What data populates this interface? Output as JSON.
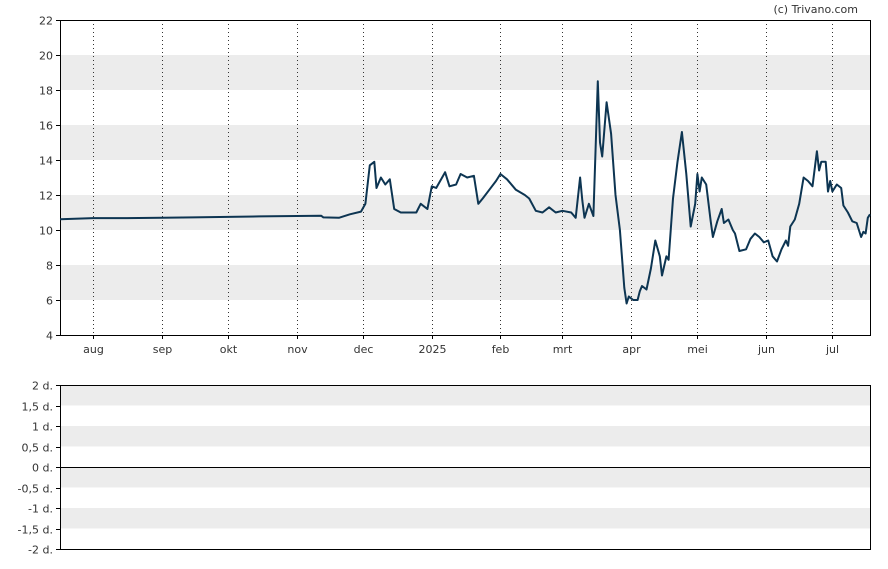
{
  "watermark": "(c) Trivano.com",
  "colors": {
    "line": "#0d3552",
    "band": "#ececec",
    "grid": "#333333",
    "axis": "#000000",
    "text": "#333333"
  },
  "chart_data": [
    {
      "type": "line",
      "title": "",
      "ylim": [
        4,
        22
      ],
      "y_ticks": [
        "4",
        "6",
        "8",
        "10",
        "12",
        "14",
        "16",
        "18",
        "20",
        "22"
      ],
      "x_tick_labels": [
        "aug",
        "sep",
        "okt",
        "nov",
        "dec",
        "2025",
        "feb",
        "mrt",
        "apr",
        "mei",
        "jun",
        "jul"
      ],
      "x_tick_dates": [
        "2024-08-01",
        "2024-09-01",
        "2024-10-01",
        "2024-11-01",
        "2024-12-01",
        "2025-01-01",
        "2025-02-01",
        "2025-03-01",
        "2025-04-01",
        "2025-05-01",
        "2025-06-01",
        "2025-07-01"
      ],
      "x_range": [
        "2024-07-17",
        "2025-07-18"
      ],
      "grid": "vertical dotted at month starts, alternating horizontal bands",
      "series": [
        {
          "points": [
            [
              "2024-07-17",
              10.62
            ],
            [
              "2024-08-01",
              10.68
            ],
            [
              "2024-08-15",
              10.68
            ],
            [
              "2024-09-01",
              10.7
            ],
            [
              "2024-09-15",
              10.72
            ],
            [
              "2024-10-01",
              10.75
            ],
            [
              "2024-10-15",
              10.78
            ],
            [
              "2024-11-01",
              10.8
            ],
            [
              "2024-11-12",
              10.82
            ],
            [
              "2024-11-13",
              10.72
            ],
            [
              "2024-11-20",
              10.7
            ],
            [
              "2024-11-25",
              10.9
            ],
            [
              "2024-11-30",
              11.05
            ],
            [
              "2024-12-02",
              11.5
            ],
            [
              "2024-12-04",
              13.7
            ],
            [
              "2024-12-06",
              13.9
            ],
            [
              "2024-12-07",
              12.4
            ],
            [
              "2024-12-09",
              13.0
            ],
            [
              "2024-12-11",
              12.6
            ],
            [
              "2024-12-13",
              12.9
            ],
            [
              "2024-12-15",
              11.2
            ],
            [
              "2024-12-18",
              11.0
            ],
            [
              "2024-12-25",
              11.0
            ],
            [
              "2024-12-27",
              11.5
            ],
            [
              "2024-12-30",
              11.2
            ],
            [
              "2025-01-01",
              12.5
            ],
            [
              "2025-01-03",
              12.4
            ],
            [
              "2025-01-07",
              13.3
            ],
            [
              "2025-01-09",
              12.5
            ],
            [
              "2025-01-12",
              12.6
            ],
            [
              "2025-01-14",
              13.2
            ],
            [
              "2025-01-17",
              13.0
            ],
            [
              "2025-01-20",
              13.1
            ],
            [
              "2025-01-22",
              11.5
            ],
            [
              "2025-01-24",
              11.8
            ],
            [
              "2025-01-27",
              12.3
            ],
            [
              "2025-01-30",
              12.8
            ],
            [
              "2025-02-01",
              13.2
            ],
            [
              "2025-02-04",
              12.9
            ],
            [
              "2025-02-08",
              12.3
            ],
            [
              "2025-02-12",
              12.0
            ],
            [
              "2025-02-14",
              11.8
            ],
            [
              "2025-02-17",
              11.1
            ],
            [
              "2025-02-20",
              11.0
            ],
            [
              "2025-02-23",
              11.3
            ],
            [
              "2025-02-26",
              11.0
            ],
            [
              "2025-03-01",
              11.1
            ],
            [
              "2025-03-05",
              11.0
            ],
            [
              "2025-03-07",
              10.7
            ],
            [
              "2025-03-09",
              13.0
            ],
            [
              "2025-03-10",
              11.7
            ],
            [
              "2025-03-11",
              10.7
            ],
            [
              "2025-03-13",
              11.5
            ],
            [
              "2025-03-15",
              10.8
            ],
            [
              "2025-03-17",
              18.5
            ],
            [
              "2025-03-18",
              15.0
            ],
            [
              "2025-03-19",
              14.2
            ],
            [
              "2025-03-21",
              17.3
            ],
            [
              "2025-03-23",
              15.5
            ],
            [
              "2025-03-25",
              12.0
            ],
            [
              "2025-03-27",
              10.0
            ],
            [
              "2025-03-29",
              6.7
            ],
            [
              "2025-03-30",
              5.8
            ],
            [
              "2025-03-31",
              6.2
            ],
            [
              "2025-04-02",
              6.0
            ],
            [
              "2025-04-04",
              6.0
            ],
            [
              "2025-04-05",
              6.5
            ],
            [
              "2025-04-06",
              6.8
            ],
            [
              "2025-04-08",
              6.6
            ],
            [
              "2025-04-10",
              7.8
            ],
            [
              "2025-04-12",
              9.4
            ],
            [
              "2025-04-14",
              8.5
            ],
            [
              "2025-04-15",
              7.4
            ],
            [
              "2025-04-17",
              8.5
            ],
            [
              "2025-04-18",
              8.3
            ],
            [
              "2025-04-20",
              11.8
            ],
            [
              "2025-04-22",
              13.9
            ],
            [
              "2025-04-24",
              15.6
            ],
            [
              "2025-04-26",
              13.2
            ],
            [
              "2025-04-28",
              10.2
            ],
            [
              "2025-04-30",
              11.5
            ],
            [
              "2025-05-01",
              13.2
            ],
            [
              "2025-05-02",
              12.2
            ],
            [
              "2025-05-03",
              13.0
            ],
            [
              "2025-05-05",
              12.6
            ],
            [
              "2025-05-07",
              10.5
            ],
            [
              "2025-05-08",
              9.6
            ],
            [
              "2025-05-10",
              10.5
            ],
            [
              "2025-05-12",
              11.2
            ],
            [
              "2025-05-13",
              10.4
            ],
            [
              "2025-05-15",
              10.6
            ],
            [
              "2025-05-17",
              10.0
            ],
            [
              "2025-05-18",
              9.8
            ],
            [
              "2025-05-20",
              8.8
            ],
            [
              "2025-05-23",
              8.9
            ],
            [
              "2025-05-25",
              9.5
            ],
            [
              "2025-05-27",
              9.8
            ],
            [
              "2025-05-29",
              9.6
            ],
            [
              "2025-05-31",
              9.3
            ],
            [
              "2025-06-02",
              9.4
            ],
            [
              "2025-06-04",
              8.5
            ],
            [
              "2025-06-06",
              8.2
            ],
            [
              "2025-06-08",
              8.9
            ],
            [
              "2025-06-10",
              9.4
            ],
            [
              "2025-06-11",
              9.1
            ],
            [
              "2025-06-12",
              10.2
            ],
            [
              "2025-06-14",
              10.6
            ],
            [
              "2025-06-16",
              11.5
            ],
            [
              "2025-06-18",
              13.0
            ],
            [
              "2025-06-20",
              12.8
            ],
            [
              "2025-06-22",
              12.5
            ],
            [
              "2025-06-24",
              14.5
            ],
            [
              "2025-06-25",
              13.4
            ],
            [
              "2025-06-26",
              13.9
            ],
            [
              "2025-06-28",
              13.9
            ],
            [
              "2025-06-29",
              12.2
            ],
            [
              "2025-06-30",
              12.8
            ],
            [
              "2025-07-01",
              12.2
            ],
            [
              "2025-07-03",
              12.6
            ],
            [
              "2025-07-05",
              12.4
            ],
            [
              "2025-07-06",
              11.4
            ],
            [
              "2025-07-08",
              11.0
            ],
            [
              "2025-07-10",
              10.5
            ],
            [
              "2025-07-12",
              10.4
            ],
            [
              "2025-07-14",
              9.6
            ],
            [
              "2025-07-15",
              9.9
            ],
            [
              "2025-07-16",
              9.8
            ],
            [
              "2025-07-17",
              10.7
            ],
            [
              "2025-07-18",
              10.9
            ]
          ]
        }
      ]
    },
    {
      "type": "line",
      "title": "",
      "ylim": [
        -2,
        2
      ],
      "y_ticks": [
        "-2 d.",
        "-1,5 d.",
        "-1 d.",
        "-0,5 d.",
        "0 d.",
        "0,5 d.",
        "1 d.",
        "1,5 d.",
        "2 d."
      ],
      "grid": "alternating horizontal bands",
      "series": [
        {
          "points": []
        }
      ]
    }
  ]
}
